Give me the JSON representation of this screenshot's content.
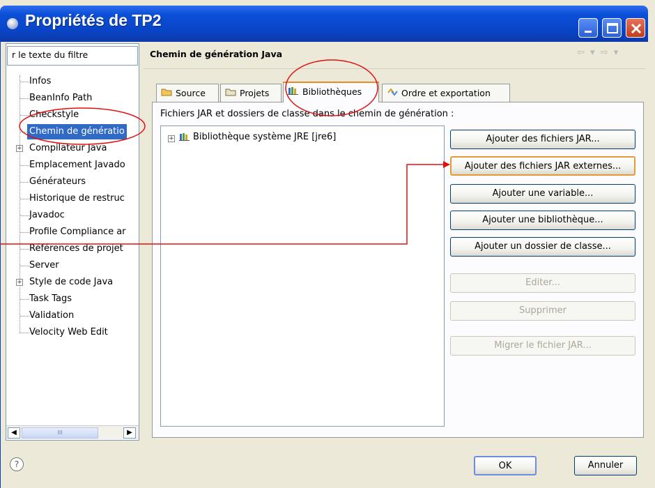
{
  "window": {
    "title": "Propriétés de TP2"
  },
  "filter": {
    "value": "r le texte du filtre"
  },
  "tree": {
    "items": [
      {
        "label": "Infos",
        "expandable": false
      },
      {
        "label": "BeanInfo Path",
        "expandable": false
      },
      {
        "label": "Checkstyle",
        "expandable": false
      },
      {
        "label": "Chemin de génératio",
        "expandable": false,
        "selected": true
      },
      {
        "label": "Compilateur Java",
        "expandable": true
      },
      {
        "label": "Emplacement Javado",
        "expandable": false
      },
      {
        "label": "Générateurs",
        "expandable": false
      },
      {
        "label": "Historique de restruc",
        "expandable": false
      },
      {
        "label": "Javadoc",
        "expandable": false
      },
      {
        "label": "Profile Compliance ar",
        "expandable": false
      },
      {
        "label": "Références de projet",
        "expandable": false
      },
      {
        "label": "Server",
        "expandable": false
      },
      {
        "label": "Style de code Java",
        "expandable": true
      },
      {
        "label": "Task Tags",
        "expandable": false
      },
      {
        "label": "Validation",
        "expandable": false
      },
      {
        "label": "Velocity Web Edit",
        "expandable": false
      }
    ]
  },
  "header": {
    "title": "Chemin de génération Java"
  },
  "tabs": [
    {
      "label": "Source",
      "icon": "source-folder-icon"
    },
    {
      "label": "Projets",
      "icon": "projects-icon"
    },
    {
      "label": "Bibliothèques",
      "icon": "library-icon",
      "active": true
    },
    {
      "label": "Ordre et exportation",
      "icon": "order-export-icon"
    }
  ],
  "panel": {
    "description": "Fichiers JAR et dossiers de classe dans le chemin de génération :",
    "entries": [
      {
        "label": "Bibliothèque système JRE [jre6]",
        "icon": "library-icon"
      }
    ]
  },
  "buttons": {
    "add_jars": "Ajouter des fichiers JAR...",
    "add_external_jars": "Ajouter des fichiers JAR externes...",
    "add_variable": "Ajouter une variable...",
    "add_library": "Ajouter une bibliothèque...",
    "add_class_folder": "Ajouter un dossier de classe...",
    "edit": "Editer...",
    "remove": "Supprimer",
    "migrate_jar": "Migrer le fichier JAR..."
  },
  "footer": {
    "help": "?",
    "ok": "OK",
    "cancel": "Annuler"
  },
  "scrollbar": {
    "thumb_grip": "III"
  },
  "colors": {
    "annotation": "#e01010",
    "selection": "#316ac5",
    "titlebar": "#0a44c6"
  }
}
